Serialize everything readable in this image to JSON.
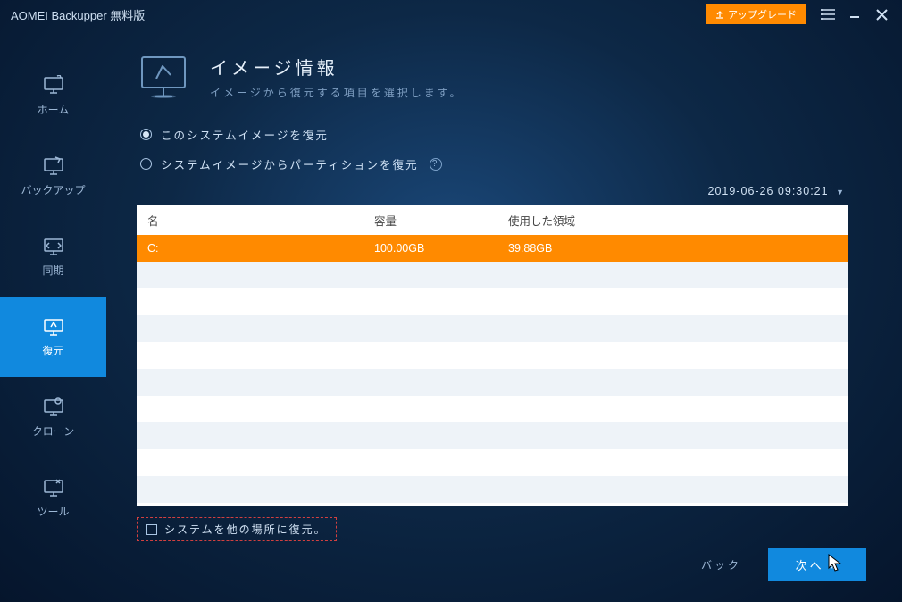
{
  "titlebar": {
    "title": "AOMEI Backupper 無料版",
    "upgrade": "アップグレード"
  },
  "sidebar": {
    "items": [
      {
        "label": "ホーム"
      },
      {
        "label": "バックアップ"
      },
      {
        "label": "同期"
      },
      {
        "label": "復元"
      },
      {
        "label": "クローン"
      },
      {
        "label": "ツール"
      }
    ]
  },
  "header": {
    "title": "イメージ情報",
    "subtitle": "イメージから復元する項目を選択します。"
  },
  "options": {
    "opt1": "このシステムイメージを復元",
    "opt2": "システムイメージからパーティションを復元"
  },
  "timestamp": "2019-06-26 09:30:21",
  "table": {
    "headers": {
      "name": "名",
      "capacity": "容量",
      "used": "使用した領域"
    },
    "rows": [
      {
        "name": "C:",
        "capacity": "100.00GB",
        "used": "39.88GB"
      }
    ]
  },
  "checkbox": {
    "label": "システムを他の場所に復元。"
  },
  "footer": {
    "back": "バック",
    "next": "次へ »"
  }
}
